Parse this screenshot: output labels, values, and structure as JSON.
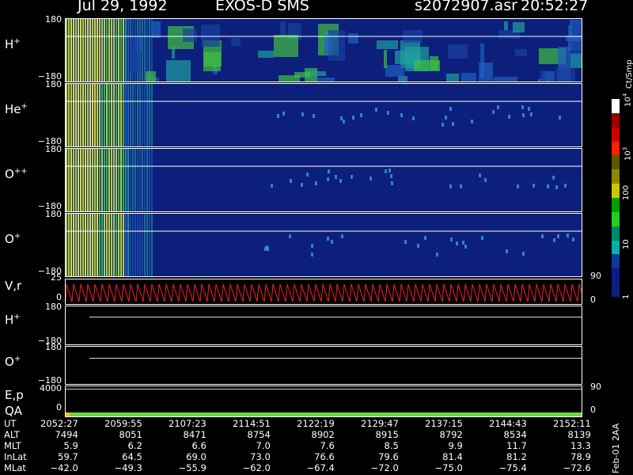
{
  "header": {
    "date": "Jul 29, 1992",
    "instrument": "EXOS-D SMS",
    "file": "s2072907.asr",
    "time": "20:52:27"
  },
  "colorbar": {
    "unit": "Ct/Smp",
    "ticks": [
      {
        "label": "10",
        "sup": "4",
        "frac": 0.0
      },
      {
        "label": "10",
        "sup": "3",
        "frac": 0.27
      },
      {
        "label": "100",
        "sup": "",
        "frac": 0.47
      },
      {
        "label": "10",
        "sup": "",
        "frac": 0.72
      },
      {
        "label": "1",
        "sup": "",
        "frac": 0.97
      }
    ],
    "colors": [
      "#ffffff",
      "#9a0000",
      "#cc0000",
      "#ff2000",
      "#5a5a00",
      "#8a8a00",
      "#c8c800",
      "#00a000",
      "#20d020",
      "#008a6a",
      "#00b0b0",
      "#0a3a9a",
      "#0c1a8a",
      "#0c1f7a"
    ]
  },
  "spectrograms": [
    {
      "species": "H",
      "charge": "+",
      "top_tick": "180",
      "bottom_tick": "−180",
      "activity": "high"
    },
    {
      "species": "He",
      "charge": "+",
      "top_tick": "180",
      "bottom_tick": "−180",
      "activity": "low"
    },
    {
      "species": "O",
      "charge": "++",
      "top_tick": "180",
      "bottom_tick": "−180",
      "activity": "low"
    },
    {
      "species": "O",
      "charge": "+",
      "top_tick": "180",
      "bottom_tick": "−180",
      "activity": "low"
    }
  ],
  "vr_panel": {
    "label": "V,r",
    "left_top": "25",
    "left_zero": "0",
    "right_top": "90",
    "right_zero": "0"
  },
  "angle_panels": [
    {
      "species": "H",
      "charge": "+",
      "top_tick": "180",
      "bottom_tick": "−180"
    },
    {
      "species": "O",
      "charge": "+",
      "top_tick": "180",
      "bottom_tick": "−180"
    }
  ],
  "ep_panel": {
    "label": "E,p",
    "sub_label": "QA",
    "left_top": "4000",
    "left_zero": "0",
    "right_top": "90",
    "right_zero": "0"
  },
  "table": {
    "row_labels": [
      "UT",
      "ALT",
      "MLT",
      "InLat",
      "MLat"
    ],
    "columns": [
      [
        "2052:27",
        "7494",
        "5.9",
        "59.7",
        "−42.0"
      ],
      [
        "2059:55",
        "8051",
        "6.2",
        "64.5",
        "−49.3"
      ],
      [
        "2107:23",
        "8471",
        "6.6",
        "69.0",
        "−55.9"
      ],
      [
        "2114:51",
        "8754",
        "7.0",
        "73.0",
        "−62.0"
      ],
      [
        "2122:19",
        "8902",
        "7.6",
        "76.6",
        "−67.4"
      ],
      [
        "2129:47",
        "8915",
        "8.5",
        "79.6",
        "−72.0"
      ],
      [
        "2137:15",
        "8792",
        "9.9",
        "81.4",
        "−75.0"
      ],
      [
        "2144:43",
        "8534",
        "11.7",
        "81.2",
        "−75.4"
      ],
      [
        "2152:11",
        "8139",
        "13.3",
        "78.9",
        "−72.6"
      ]
    ]
  },
  "footer": "Feb-01 2AA",
  "chart_data": {
    "type": "heatmap",
    "x": [
      "2052:27",
      "2059:55",
      "2107:23",
      "2114:51",
      "2122:19",
      "2129:47",
      "2137:15",
      "2144:43",
      "2152:11"
    ],
    "xlabel": "UT",
    "ylim": [
      -180,
      180
    ],
    "series": [
      {
        "name": "H+",
        "values": []
      },
      {
        "name": "He+",
        "values": []
      },
      {
        "name": "O++",
        "values": []
      },
      {
        "name": "O+",
        "values": []
      }
    ]
  }
}
